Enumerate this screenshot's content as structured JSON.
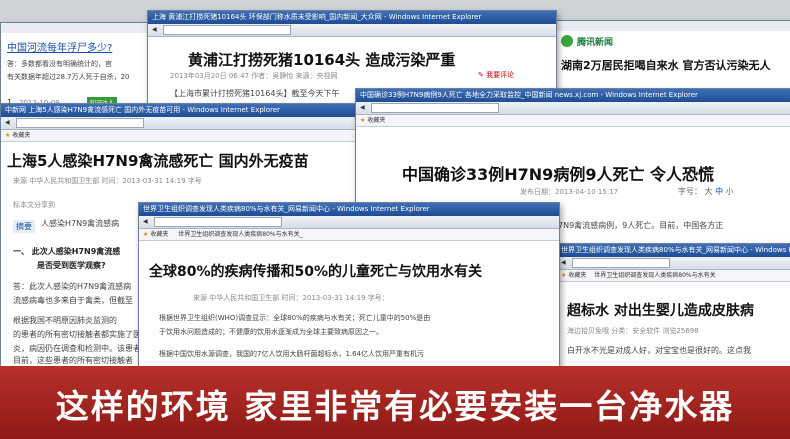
{
  "w1": {
    "headline": "中国河流每年浮尸多少?",
    "line1": "答：多数都看没有明确统计的，官",
    "line2": "有关数据年超过28.7万人死于自杀，20",
    "date": "2012-10-09",
    "num": "1",
    "badge": "知识达人"
  },
  "w2": {
    "title": "上海 黄浦江打捞死猪10164头 环保部门称水质未受影响_国内新闻_大众网 - Windows Internet Explorer",
    "headline": "黄浦江打捞死猪10164头  造成污染严重",
    "meta": "2013年03月20日 06:47   作者：吴静怡   来源：央视网",
    "comment": "我要评论",
    "body": "【上海市累计打捞死猪10164头】截至今天下午"
  },
  "w3": {
    "brand": "腾讯新闻",
    "headline": "湖南2万居民拒喝自来水 官方否认污染无人"
  },
  "w4": {
    "title": "中新网 上海5人感染H7N9禽流感死亡 国内外无疫苗可用 - Windows Internet Explorer",
    "fav": "收藏夹",
    "headline": "上海5人感染H7N9禽流感死亡  国内外无疫苗",
    "meta": "来源 中华人民共和国卫生部    时间：2013-03-31 14:19    字号",
    "article_tag": "标本文分享到",
    "summary_label": "摘要",
    "summary_text": "人感染H7N9禽流感病",
    "q": "一、  此次人感染H7N9禽流感",
    "q2": "是否受到医学观察?",
    "p1": "答：此次人感染的H7N9禽流感病",
    "p2": "流感病毒也多来自于禽类，但截至",
    "p3": "根据我国不明原因肺炎监测的",
    "p4": "的患者的所有密切接触者都实施了医",
    "p5": "炎，病因仍在调查和检测中。该患者",
    "p6": "目前，这些患者的所有密切接触者"
  },
  "w5": {
    "title": "中国确诊33例H7N9病例9人死亡 各地全力采取监控_中国新闻 news.xj.com - Windows Internet Explorer",
    "fav": "收藏夹",
    "headline": "中国确诊33例H7N9病例9人死亡  令人恐慌",
    "meta": "发布日期：2013-04-10 15:17",
    "font_label": "字号：",
    "font_big": "大",
    "font_mid": "中",
    "font_small": "小",
    "body": "H7N9禽流感病例，9人死亡。目前，中国各方正"
  },
  "w6": {
    "title": "世界卫生组织调查发现人类疾病80%与水有关_网易新闻中心 - Windows Internet Explorer",
    "fav": "收藏夹",
    "tab": "世界卫生组织调查发现人类疾病80%与水有关_",
    "headline": "全球80%的疾病传播和50%的儿童死亡与饮用水有关",
    "meta": "来源 中华人民共和国卫生部    时间：2013-03-31 14:19    字号：",
    "p1": "根据世界卫生组织(WHO)调查显示：全球80%的疾病与水有关；死亡儿童中的50%是由",
    "p2": "于饮用水问题造成的；不健康的饮用水逐渐成为全球主要致病原因之一。",
    "p3": "根据中国饮用水源调查，我国的7亿人饮用大肠杆菌超标水，1.64亿人饮用严重有机污"
  },
  "w7": {
    "title": "世界卫生组织调查发现人类疾病80%与水有关_网易新闻中心 - Windows Internet Explorer",
    "fav": "收藏夹",
    "tab": "世界卫生组织调查发现人类疾病80%与水有关",
    "headline": "超标水 对出生婴儿造成皮肤病",
    "meta": "海边拾贝免哦   分类：安全软件   浏览25698",
    "body": "白开水不光是对成人好，对宝宝也是很好的。这点我"
  },
  "banner": {
    "text": "这样的环境  家里非常有必要安装一台净水器"
  }
}
